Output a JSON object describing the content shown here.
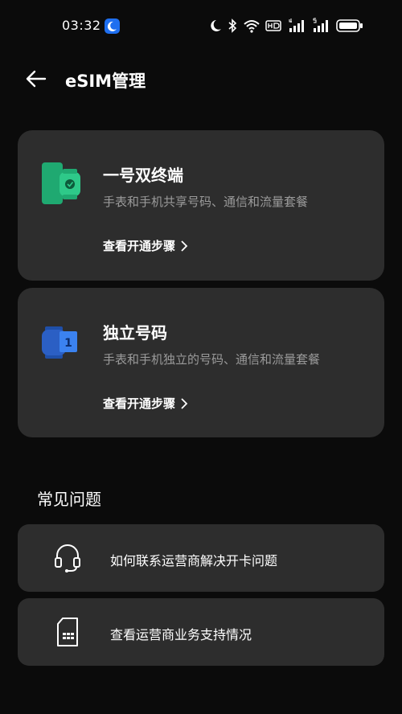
{
  "status_bar": {
    "time": "03:32",
    "icons": [
      "moon-icon",
      "bluetooth-icon",
      "wifi-icon",
      "hd-icon",
      "signal-4g-icon",
      "signal-5g-icon",
      "battery-icon"
    ]
  },
  "header": {
    "title": "eSIM管理"
  },
  "cards": [
    {
      "title": "一号双终端",
      "description": "手表和手机共享号码、通信和流量套餐",
      "link": "查看开通步骤",
      "icon": "phone-watch-shared-icon",
      "accent": "#1fa971"
    },
    {
      "title": "独立号码",
      "description": "手表和手机独立的号码、通信和流量套餐",
      "link": "查看开通步骤",
      "icon": "watch-independent-number-icon",
      "accent": "#2b6ce0"
    }
  ],
  "faq": {
    "title": "常见问题",
    "items": [
      {
        "label": "如何联系运营商解决开卡问题",
        "icon": "headset-icon"
      },
      {
        "label": "查看运营商业务支持情况",
        "icon": "sim-card-icon"
      }
    ]
  },
  "colors": {
    "background": "#0b0b0b",
    "card": "#2d2d2d",
    "secondary_text": "#9a9a9a"
  }
}
